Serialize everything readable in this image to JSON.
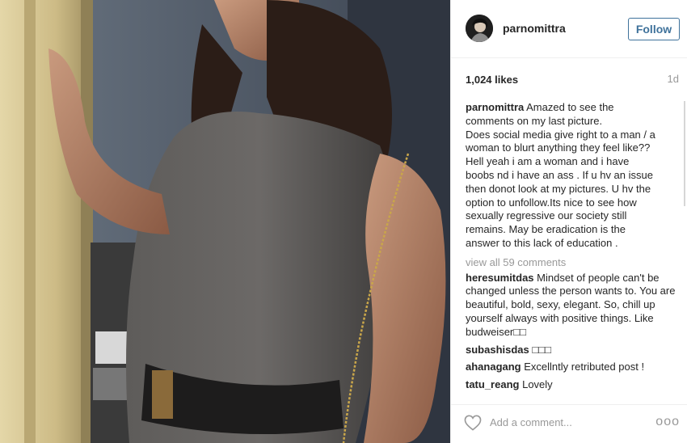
{
  "post": {
    "username": "parnomittra",
    "follow_label": "Follow",
    "likes": "1,024 likes",
    "age": "1d",
    "caption_author": "parnomittra",
    "caption_lines": [
      "Amazed to see the",
      "comments on my last picture.",
      "Does social media give right to a man / a",
      "woman to blurt anything they feel like??",
      "Hell yeah i am a woman and i have",
      "boobs nd i have an ass . If u hv an issue",
      "then donot look at my pictures. U hv the",
      "option to unfollow.Its nice to see how",
      "sexually regressive our society still",
      "remains. May be eradication is the",
      "answer to this lack of education ."
    ],
    "view_all_comments": "view all 59 comments",
    "comments": [
      {
        "author": "heresumitdas",
        "text": "Mindset of people can't be changed unless the person wants to. You are beautiful, bold, sexy, elegant. So, chill up yourself always with positive things. Like budweiser□□"
      },
      {
        "author": "subashisdas",
        "text": "□□□"
      },
      {
        "author": "ahanagang",
        "text": "Excellntly retributed post !"
      },
      {
        "author": "tatu_reang",
        "text": "Lovely"
      }
    ],
    "add_comment_placeholder": "Add a comment...",
    "more_label": "ooo"
  },
  "colors": {
    "follow_blue": "#3f729b",
    "muted_gray": "#999999",
    "divider": "#efefef"
  },
  "icons": {
    "like": "heart-outline-icon",
    "options": "more-options-icon"
  }
}
